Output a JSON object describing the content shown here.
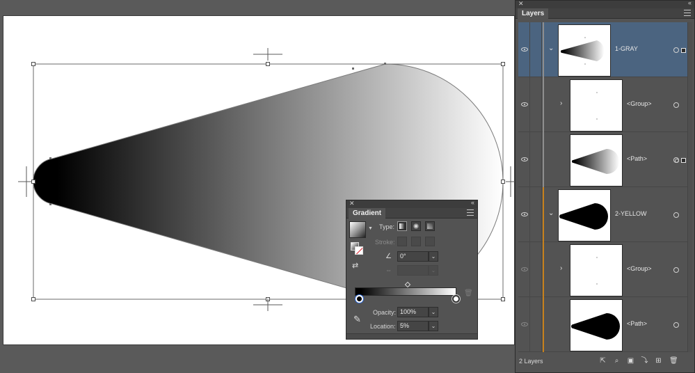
{
  "layers_panel": {
    "title": "Layers",
    "count_label": "2 Layers",
    "rows": [
      {
        "name": "1-GRAY",
        "visible": true,
        "expanded": true
      },
      {
        "name": "<Group>",
        "visible": true,
        "expanded": false
      },
      {
        "name": "<Path>",
        "visible": true
      },
      {
        "name": "2-YELLOW",
        "visible": true,
        "expanded": true
      },
      {
        "name": "<Group>",
        "visible": false,
        "expanded": false
      },
      {
        "name": "<Path>",
        "visible": false
      }
    ]
  },
  "gradient_panel": {
    "title": "Gradient",
    "type_label": "Type:",
    "stroke_label": "Stroke:",
    "angle": "0°",
    "opacity_label": "Opacity:",
    "opacity": "100%",
    "location_label": "Location:",
    "location": "5%"
  },
  "colors": {
    "selection_row": "#4b6480",
    "layer1_color": "#8e8e8e",
    "layer2_color": "#c8811b",
    "panel_bg": "#535353"
  }
}
